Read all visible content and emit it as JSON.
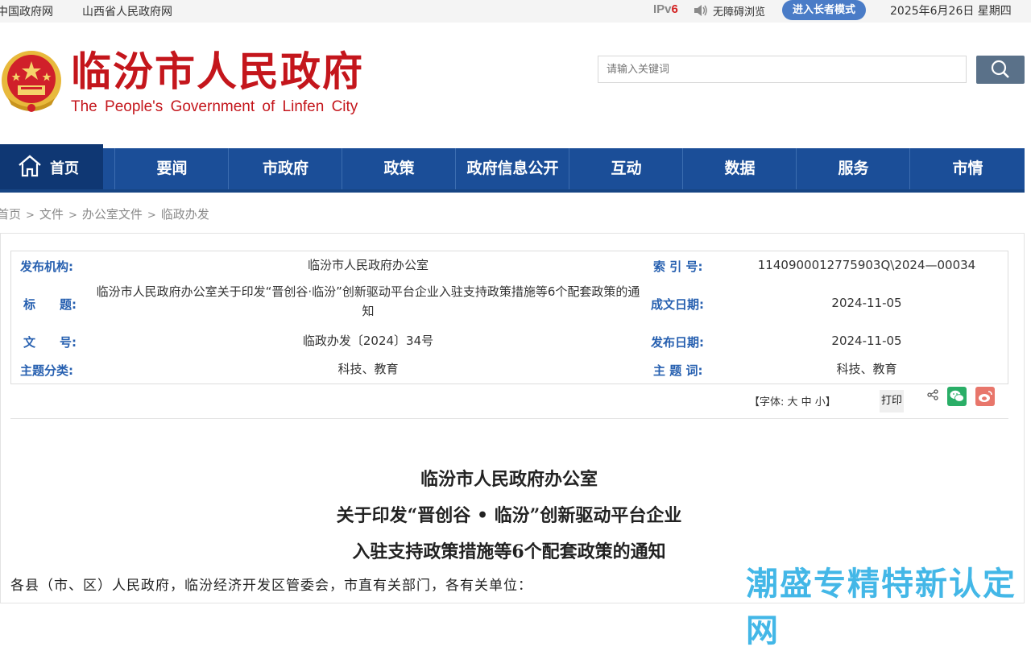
{
  "topbar": {
    "link1": "中国政府网",
    "link2": "山西省人民政府网",
    "ipv6_prefix": "IPv",
    "ipv6_suffix": "6",
    "accessibility": "无障碍浏览",
    "elder_mode": "进入长者模式",
    "date": "2025年6月26日 星期四"
  },
  "header": {
    "title": "临汾市人民政府",
    "subtitle_en": "The People's Government of Linfen City",
    "search_placeholder": "请输入关键词"
  },
  "nav": {
    "home": "首页",
    "items": [
      "要闻",
      "市政府",
      "政策",
      "政府信息公开",
      "互动",
      "数据",
      "服务",
      "市情"
    ]
  },
  "breadcrumb": [
    "首页",
    "文件",
    "办公室文件",
    "临政办发"
  ],
  "breadcrumb_sep": ">",
  "meta": {
    "publisher_label": "发布机构:",
    "publisher": "临汾市人民政府办公室",
    "index_label": "索 引 号:",
    "index": "1140900012775903Q\\2024—00034",
    "title_label": "标　　题:",
    "title": "临汾市人民政府办公室关于印发“晋创谷·临汾”创新驱动平台企业入驻支持政策措施等6个配套政策的通知",
    "created_label": "成文日期:",
    "created": "2024-11-05",
    "docno_label": "文　　号:",
    "docno": "临政办发〔2024〕34号",
    "published_label": "发布日期:",
    "published": "2024-11-05",
    "category_label": "主题分类:",
    "category": "科技、教育",
    "keywords_label": "主 题 词:",
    "keywords": "科技、教育"
  },
  "tools": {
    "font_size": "【字体: 大 中 小】",
    "print": "打印"
  },
  "document": {
    "title_line1": "临汾市人民政府办公室",
    "title_line2": "关于印发“晋创谷 • 临汾”创新驱动平台企业",
    "title_line3": "入驻支持政策措施等6个配套政策的通知",
    "salutation": "各县（市、区）人民政府，临汾经济开发区管委会，市直有关部门，各有关单位："
  },
  "watermark": "潮盛专精特新认定网",
  "colors": {
    "brand_red": "#c4161c",
    "nav_blue": "#1b4e98",
    "label_blue": "#2760b0",
    "elder_button": "#4a7cc7"
  }
}
